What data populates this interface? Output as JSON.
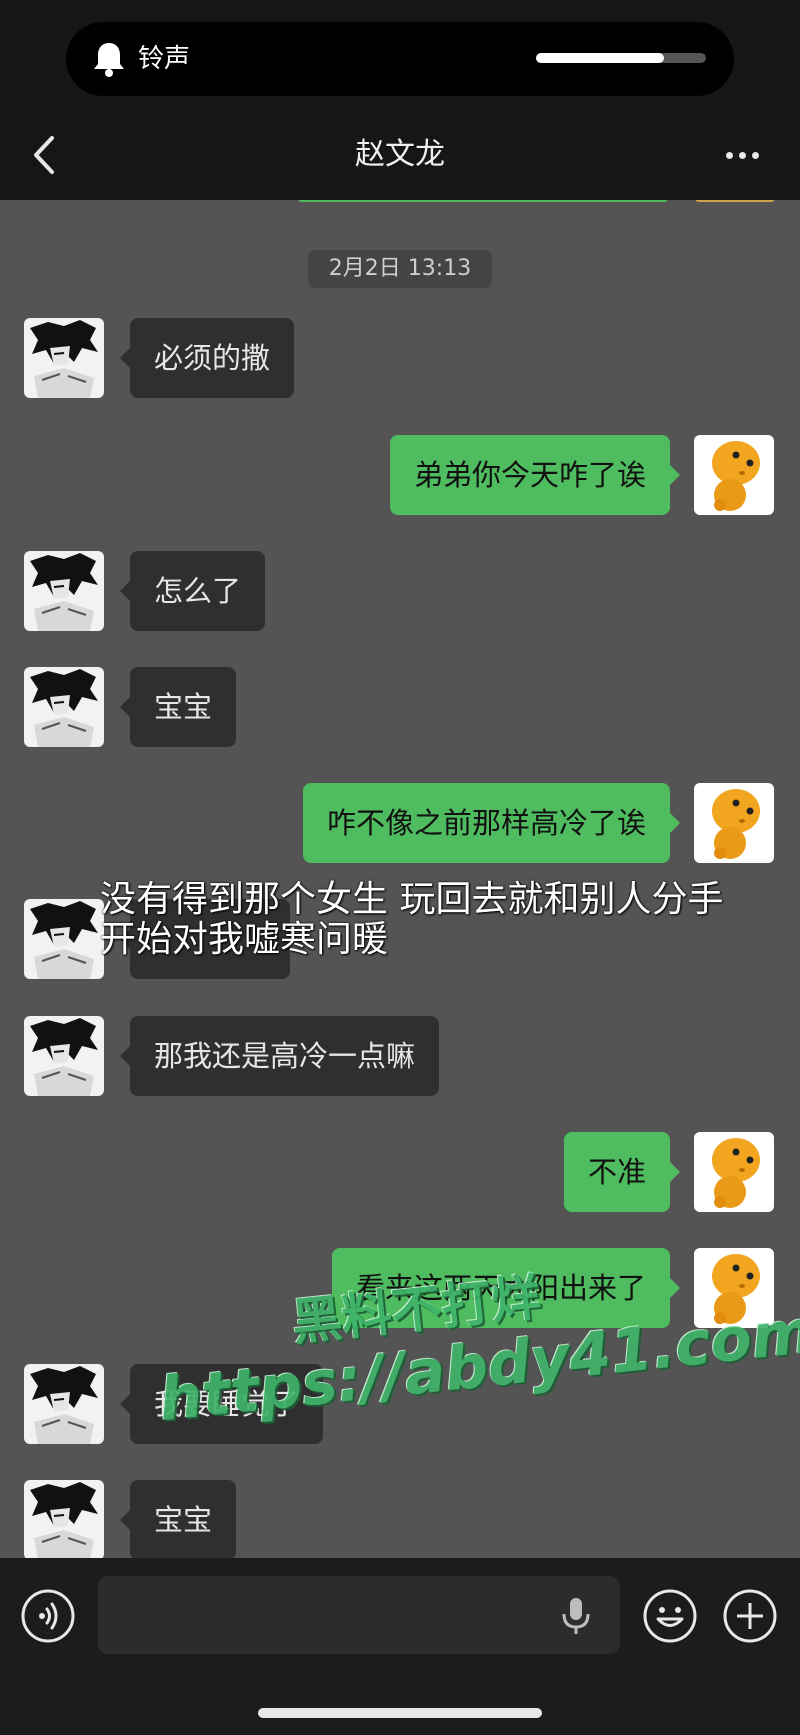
{
  "status": {
    "ringer_label": "铃声",
    "volume_fraction": 0.75
  },
  "header": {
    "title": "赵文龙",
    "back_icon": "chevron-left-icon",
    "more_icon": "ellipsis-icon"
  },
  "chat": {
    "timestamp": "2月2日 13:13",
    "messages": [
      {
        "side": "left",
        "text": "必须的撒"
      },
      {
        "side": "right",
        "text": "弟弟你今天咋了诶"
      },
      {
        "side": "left",
        "text": "怎么了"
      },
      {
        "side": "left",
        "text": "宝宝"
      },
      {
        "side": "right",
        "text": "咋不像之前那样高冷了诶"
      },
      {
        "side": "left",
        "text": ""
      },
      {
        "side": "left",
        "text": "那我还是高冷一点嘛"
      },
      {
        "side": "right",
        "text": "不准"
      },
      {
        "side": "right",
        "text": "看来这两天太阳出来了"
      },
      {
        "side": "left",
        "text": "我要睡觉了"
      },
      {
        "side": "left",
        "text": "宝宝"
      }
    ]
  },
  "overlay": {
    "caption_line1": "没有得到那个女生 玩回去就和别人分手",
    "caption_line2": "开始对我嘘寒问暖"
  },
  "watermark": {
    "line1": "黑料不打烊",
    "line2": "https://abdy41.com"
  },
  "input_bar": {
    "placeholder": "",
    "voice_icon": "voice-icon",
    "mic_icon": "mic-icon",
    "emoji_icon": "emoji-icon",
    "plus_icon": "plus-icon"
  },
  "colors": {
    "chat_background": "#545454",
    "sent_bubble": "#4fbd5f",
    "received_bubble": "#2f2f2f",
    "header": "#161616"
  }
}
